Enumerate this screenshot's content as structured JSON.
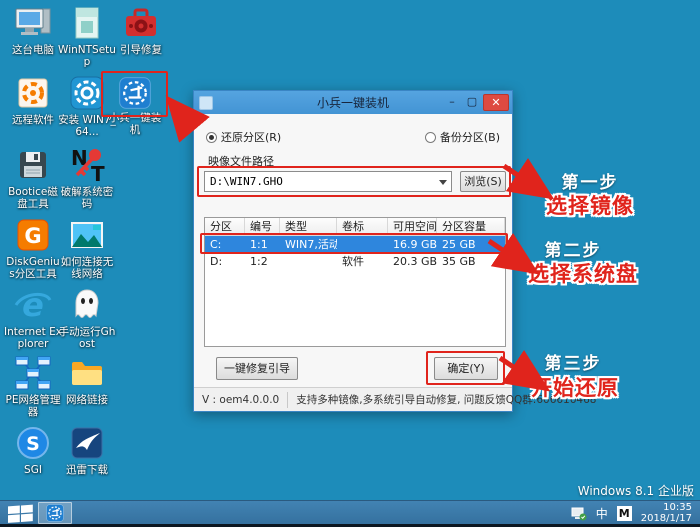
{
  "desktop": {
    "os_label": "Windows 8.1 企业版",
    "icons": [
      {
        "name": "this-pc",
        "label": "这台电脑"
      },
      {
        "name": "winntsetup",
        "label": "WinNTSetup"
      },
      {
        "name": "boot-repair",
        "label": "引导修复"
      },
      {
        "name": "remote-software",
        "label": "远程软件"
      },
      {
        "name": "install-win7",
        "label": "安装 WIN7_64..."
      },
      {
        "name": "xiaobing-installer",
        "label": "小兵一键装机"
      },
      {
        "name": "bootice",
        "label": "Bootice磁盘工具"
      },
      {
        "name": "crack-password",
        "label": "破解系统密码"
      },
      {
        "name": "diskgenius",
        "label": "DiskGenius分区工具"
      },
      {
        "name": "wireless-guide",
        "label": "如何连接无线网络"
      },
      {
        "name": "internet-explorer",
        "label": "Internet Explorer"
      },
      {
        "name": "ghost",
        "label": "手动运行Ghost"
      },
      {
        "name": "pe-network-manager",
        "label": "PE网络管理器"
      },
      {
        "name": "network-link",
        "label": "网络链接"
      },
      {
        "name": "sgi",
        "label": "SGI"
      },
      {
        "name": "thunder",
        "label": "迅雷下载"
      }
    ]
  },
  "dialog": {
    "title": "小兵一键装机",
    "minimize": "–",
    "maximize": "▢",
    "close": "✕",
    "radio_restore": "还原分区(R)",
    "radio_backup": "备份分区(B)",
    "path_label": "映像文件路径",
    "path_value": "D:\\WIN7.GHO",
    "browse_button": "浏览(S)",
    "table": {
      "headers": [
        "分区",
        "编号",
        "类型",
        "卷标",
        "可用空间",
        "分区容量"
      ],
      "rows": [
        [
          "C:",
          "1:1",
          "WIN7,活动",
          "",
          "16.9 GB",
          "25 GB"
        ],
        [
          "D:",
          "1:2",
          "",
          "软件",
          "20.3 GB",
          "35 GB"
        ]
      ]
    },
    "repair_button": "一键修复引导",
    "ok_button": "确定(Y)",
    "version": "V : oem4.0.0.0",
    "status_text": "支持多种镜像,多系统引导自动修复, 问题反馈QQ群:606616468"
  },
  "annotations": {
    "step1": {
      "title": "第一步",
      "subtitle": "选择镜像"
    },
    "step2": {
      "title": "第二步",
      "subtitle": "选择系统盘"
    },
    "step3": {
      "title": "第三步",
      "subtitle": "开始还原"
    }
  },
  "taskbar": {
    "ime_lang": "中",
    "ime_mode": "M",
    "time": "10:35",
    "date": "2018/1/17"
  },
  "colors": {
    "desktop_bg": "#1d8cba",
    "annotation_red": "#e0241c",
    "selected_row_blue": "#2e86dd",
    "titlebar_blue": "#4394d4"
  }
}
